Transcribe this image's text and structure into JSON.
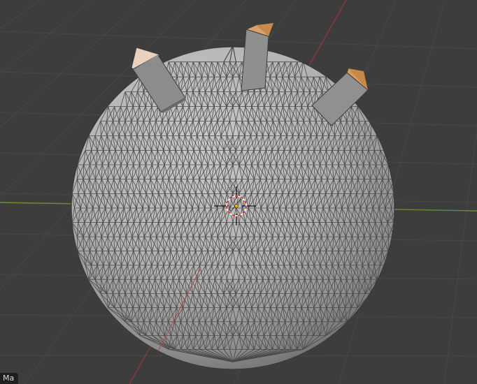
{
  "viewport": {
    "background": "#3d3d3d",
    "mode_label": "Ma"
  },
  "scene": {
    "object": "icosphere",
    "tri_color": "#b6b6b6",
    "spike_count": 3,
    "spike_body_color": "#8a8a8a",
    "spike_tip_color": "#e0a060",
    "axis_x_color": "#9a3a3a",
    "axis_y_color": "#6f8f3a",
    "grid_line_color": "#4a4a4a",
    "cursor": "3d-cursor-icon"
  }
}
